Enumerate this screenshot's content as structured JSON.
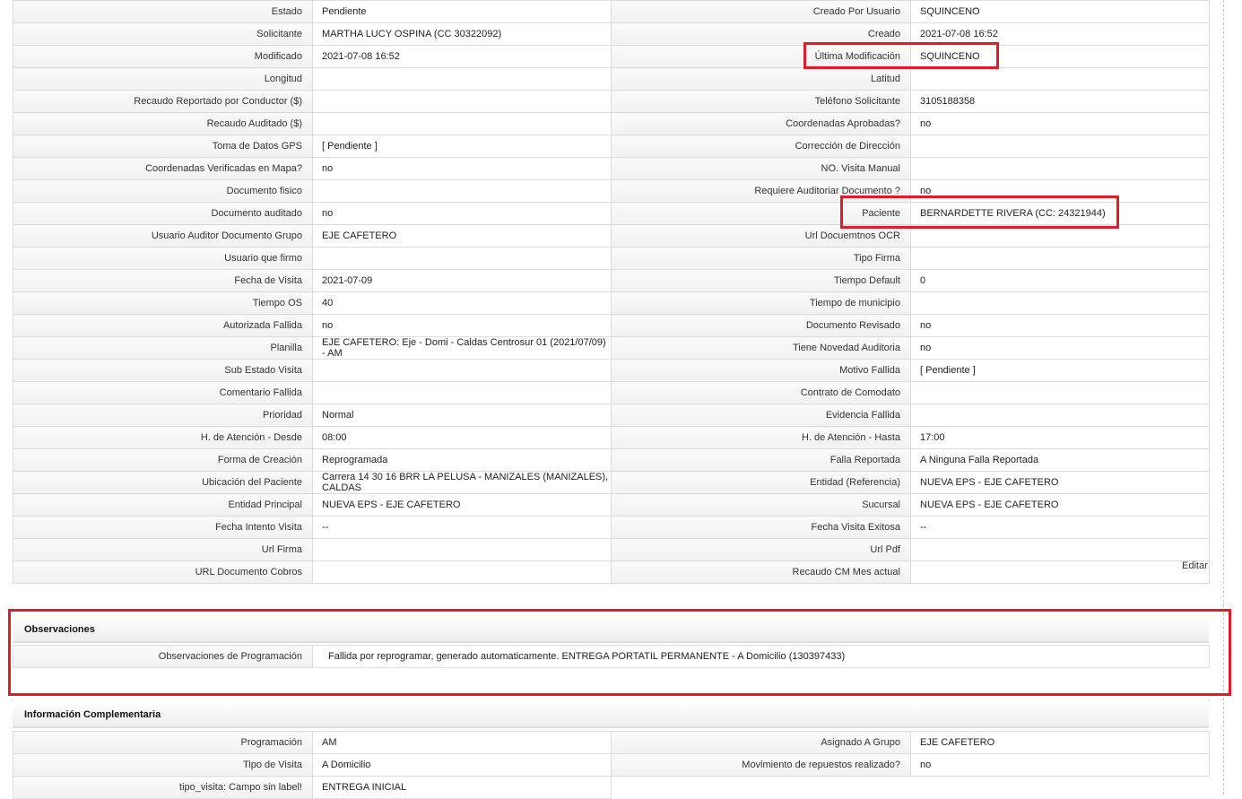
{
  "main_rows": [
    {
      "l1": "Estado",
      "v1": "Pendiente",
      "l2": "Creado Por Usuario",
      "v2": "SQUINCENO"
    },
    {
      "l1": "Solicitante",
      "v1": "MARTHA LUCY OSPINA (CC 30322092)",
      "l2": "Creado",
      "v2": "2021-07-08 16:52"
    },
    {
      "l1": "Modificado",
      "v1": "2021-07-08 16:52",
      "l2": "Última Modificación",
      "v2": "SQUINCENO"
    },
    {
      "l1": "Longitud",
      "v1": "",
      "l2": "Latitud",
      "v2": ""
    },
    {
      "l1": "Recaudo Reportado por Conductor ($)",
      "v1": "",
      "l2": "Teléfono Solicitante",
      "v2": "3105188358"
    },
    {
      "l1": "Recaudo Auditado ($)",
      "v1": "",
      "l2": "Coordenadas Aprobadas?",
      "v2": "no"
    },
    {
      "l1": "Toma de Datos GPS",
      "v1": "[ Pendiente ]",
      "l2": "Corrección de Dirección",
      "v2": ""
    },
    {
      "l1": "Coordenadas Verificadas en Mapa?",
      "v1": "no",
      "l2": "NO. Visita Manual",
      "v2": ""
    },
    {
      "l1": "Documento fisico",
      "v1": "",
      "l2": "Requiere Auditoriar Documento ?",
      "v2": "no"
    },
    {
      "l1": "Documento auditado",
      "v1": "no",
      "l2": "Paciente",
      "v2": "BERNARDETTE RIVERA (CC: 24321944)"
    },
    {
      "l1": "Usuario Auditor Documento Grupo",
      "v1": "EJE CAFETERO",
      "l2": "Url Docuemtnos OCR",
      "v2": ""
    },
    {
      "l1": "Usuario que firmo",
      "v1": "",
      "l2": "Tipo Firma",
      "v2": ""
    },
    {
      "l1": "Fecha de Visita",
      "v1": "2021-07-09",
      "l2": "Tiempo Default",
      "v2": "0"
    },
    {
      "l1": "Tiempo OS",
      "v1": "40",
      "l2": "Tiempo de municipio",
      "v2": ""
    },
    {
      "l1": "Autorizada Fallida",
      "v1": "no",
      "l2": "Documento Revisado",
      "v2": "no"
    },
    {
      "l1": "Planilla",
      "v1": "EJE CAFETERO: Eje - Domi - Caldas Centrosur 01 (2021/07/09) - AM",
      "l2": "Tiene Novedad Auditoria",
      "v2": "no"
    },
    {
      "l1": "Sub Estado Visita",
      "v1": "",
      "l2": "Motivo Fallida",
      "v2": "[ Pendiente ]"
    },
    {
      "l1": "Comentario Fallida",
      "v1": "",
      "l2": "Contrato de Comodato",
      "v2": ""
    },
    {
      "l1": "Prioridad",
      "v1": "Normal",
      "l2": "Evidencia Fallida",
      "v2": ""
    },
    {
      "l1": "H. de Atención - Desde",
      "v1": "08:00",
      "l2": "H. de Atención - Hasta",
      "v2": "17:00"
    },
    {
      "l1": "Forma de Creación",
      "v1": "Reprogramada",
      "l2": "Falla Reportada",
      "v2": "A Ninguna Falla Reportada"
    },
    {
      "l1": "Ubicación del Paciente",
      "v1": "Carrera 14 30 16 BRR LA PELUSA - MANIZALES (MANIZALES), CALDAS",
      "l2": "Entidad (Referencia)",
      "v2": "NUEVA EPS - EJE CAFETERO"
    },
    {
      "l1": "Entidad Principal",
      "v1": "NUEVA EPS - EJE CAFETERO",
      "l2": "Sucursal",
      "v2": "NUEVA EPS - EJE CAFETERO"
    },
    {
      "l1": "Fecha Intento Visita",
      "v1": "--",
      "l2": "Fecha Visita Exitosa",
      "v2": "--"
    },
    {
      "l1": "Url Firma",
      "v1": "",
      "l2": "Url Pdf",
      "v2": ""
    },
    {
      "l1": "URL Documento Cobros",
      "v1": "",
      "l2": "Recaudo CM Mes actual",
      "v2": ""
    }
  ],
  "edit_label": "Editar",
  "observaciones": {
    "title": "Observaciones",
    "label": "Observaciones de Programación",
    "value": "Fallida por reprogramar, generado automaticamente. ENTREGA PORTATIL PERMANENTE - A Domicilio (130397433)"
  },
  "complementaria": {
    "title": "Información Complementaria",
    "rows": [
      {
        "l1": "Programación",
        "v1": "AM",
        "l2": "Asignado A Grupo",
        "v2": "EJE CAFETERO"
      },
      {
        "l1": "Tipo de Visita",
        "v1": "A Domicilio",
        "l2": "Movimiento de repuestos realizado?",
        "v2": "no"
      },
      {
        "l1": "tipo_visita: Campo sin label!",
        "v1": "ENTREGA INICIAL"
      }
    ]
  },
  "highlight_color": "#e21b2b"
}
